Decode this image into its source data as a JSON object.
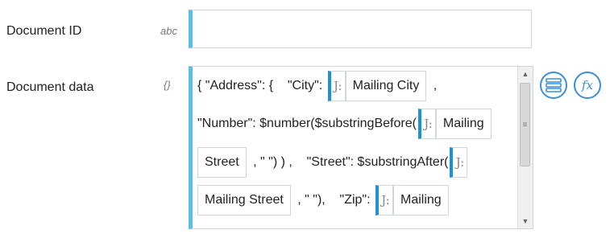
{
  "fields": {
    "document_id": {
      "label": "Document ID",
      "type_hint": "abc",
      "value": ""
    },
    "document_data": {
      "label": "Document data",
      "type_hint": "{}",
      "lines": [
        {
          "parts": [
            {
              "kind": "text",
              "value": "{ \"Address\": {    \"City\": "
            },
            {
              "kind": "icon",
              "value": "J:"
            },
            {
              "kind": "pill",
              "value": "Mailing City"
            },
            {
              "kind": "text",
              "value": " ,"
            }
          ]
        },
        {
          "parts": [
            {
              "kind": "text",
              "value": "\"Number\": $number($substringBefore("
            },
            {
              "kind": "icon",
              "value": "J:"
            },
            {
              "kind": "pill",
              "value": "Mailing"
            }
          ]
        },
        {
          "parts": [
            {
              "kind": "pill",
              "value": "Street"
            },
            {
              "kind": "text",
              "value": " , \" \") ) ,    \"Street\": $substringAfter("
            },
            {
              "kind": "icon",
              "value": "J:"
            }
          ]
        },
        {
          "parts": [
            {
              "kind": "pill",
              "value": "Mailing Street"
            },
            {
              "kind": "text",
              "value": " , \" \"),    \"Zip\": "
            },
            {
              "kind": "icon",
              "value": "J:"
            },
            {
              "kind": "pill",
              "value": "Mailing"
            }
          ]
        }
      ]
    }
  },
  "buttons": {
    "list_icon": "list-icon",
    "fx_label": "fx"
  },
  "colors": {
    "accent": "#5bc0e8",
    "pill_accent": "#1e90d8",
    "button_blue": "#3a8fd6"
  }
}
